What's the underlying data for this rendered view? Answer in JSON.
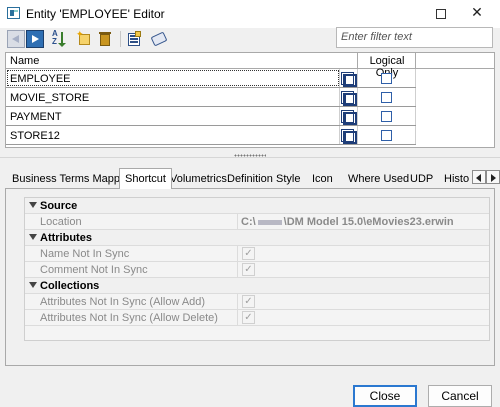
{
  "window": {
    "title": "Entity 'EMPLOYEE' Editor",
    "maximize_label": "",
    "close_label": "✕"
  },
  "toolbar": {
    "tools": [
      "previous-icon",
      "next-icon",
      "sort-az-icon",
      "new-icon",
      "delete-icon",
      "properties-icon",
      "tag-icon"
    ],
    "sort_a": "A",
    "sort_z": "Z"
  },
  "filter": {
    "placeholder": "Enter filter text"
  },
  "grid": {
    "columns": {
      "name": "Name",
      "logical_only": "Logical Only"
    },
    "rows": [
      {
        "name": "EMPLOYEE",
        "logical_only": false
      },
      {
        "name": "MOVIE_STORE",
        "logical_only": false
      },
      {
        "name": "PAYMENT",
        "logical_only": false
      },
      {
        "name": "STORE12",
        "logical_only": false
      }
    ]
  },
  "tabs": {
    "items": [
      "Business Terms Mapping",
      "Shortcut",
      "Volumetrics",
      "Definition",
      "Style",
      "Icon",
      "Where Used",
      "UDP",
      "Histo"
    ],
    "active": "Shortcut"
  },
  "properties": {
    "source": {
      "header": "Source",
      "location_label": "Location",
      "location_prefix": "C:\\",
      "location_suffix": "\\DM Model 15.0\\eMovies23.erwin"
    },
    "attributes": {
      "header": "Attributes",
      "name_not_in_sync": "Name Not In Sync",
      "comment_not_in_sync": "Comment Not In Sync"
    },
    "collections": {
      "header": "Collections",
      "allow_add": "Attributes Not In Sync (Allow Add)",
      "allow_delete": "Attributes Not In Sync (Allow Delete)"
    },
    "checkmark": "✓"
  },
  "footer": {
    "close_label": "Close",
    "cancel_label": "Cancel"
  }
}
